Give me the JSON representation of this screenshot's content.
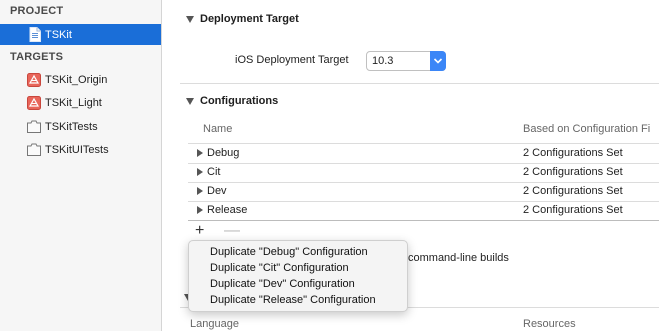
{
  "sidebar": {
    "project_header": "PROJECT",
    "project_item": "TSKit",
    "targets_header": "TARGETS",
    "targets": [
      {
        "label": "TSKit_Origin",
        "icon": "app-target-icon"
      },
      {
        "label": "TSKit_Light",
        "icon": "app-target-icon"
      },
      {
        "label": "TSKitTests",
        "icon": "test-bundle-icon"
      },
      {
        "label": "TSKitUITests",
        "icon": "test-bundle-icon"
      }
    ]
  },
  "deployment": {
    "title": "Deployment Target",
    "ios_label": "iOS Deployment Target",
    "ios_value": "10.3"
  },
  "configurations": {
    "title": "Configurations",
    "columns": [
      "Name",
      "Based on Configuration Fi"
    ],
    "rows": [
      {
        "name": "Debug",
        "based_on": "2 Configurations Set"
      },
      {
        "name": "Cit",
        "based_on": "2 Configurations Set"
      },
      {
        "name": "Dev",
        "based_on": "2 Configurations Set"
      },
      {
        "name": "Release",
        "based_on": "2 Configurations Set"
      }
    ],
    "add_label": "+",
    "remove_label": "—",
    "command_line_text": "command-line builds"
  },
  "menu": {
    "items": [
      "Duplicate \"Debug\" Configuration",
      "Duplicate \"Cit\" Configuration",
      "Duplicate \"Dev\" Configuration",
      "Duplicate \"Release\" Configuration"
    ]
  },
  "localizations": {
    "columns": [
      "Language",
      "Resources"
    ]
  },
  "colors": {
    "selection": "#1a6ed8",
    "popup_accent": "#3b86f7"
  }
}
